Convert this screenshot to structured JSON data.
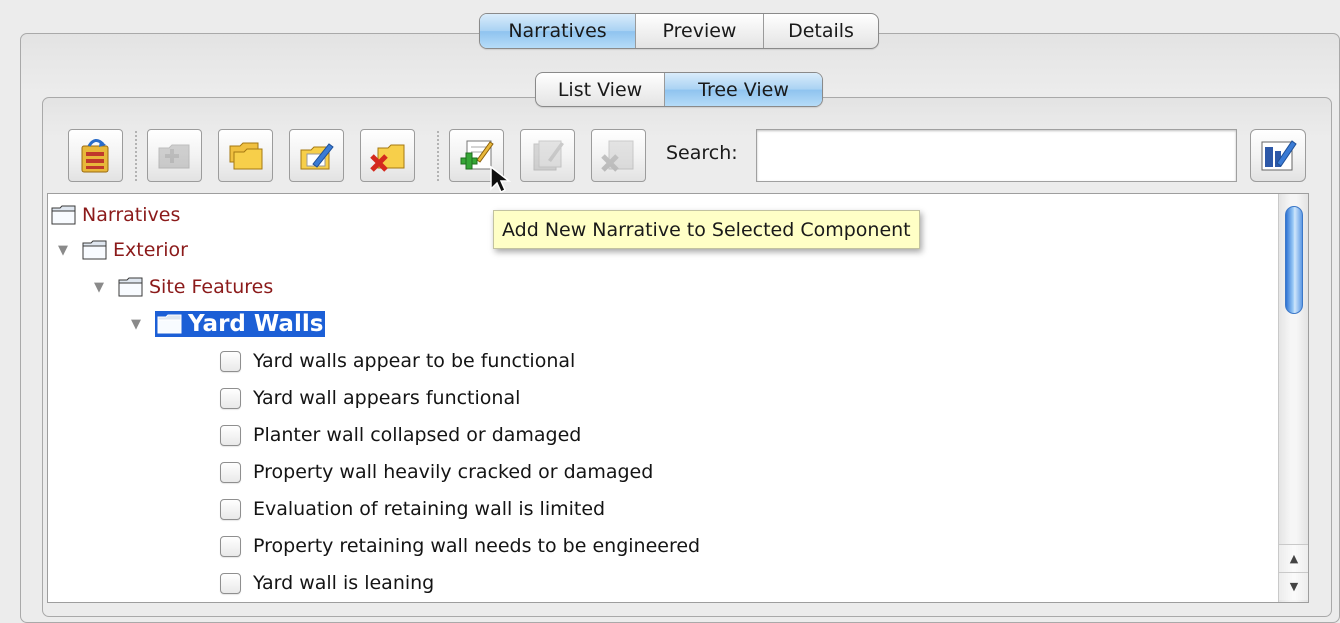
{
  "top_tabs": [
    {
      "label": "Narratives",
      "selected": true
    },
    {
      "label": "Preview",
      "selected": false
    },
    {
      "label": "Details",
      "selected": false
    }
  ],
  "view_tabs": [
    {
      "label": "List View",
      "selected": false
    },
    {
      "label": "Tree View",
      "selected": true
    }
  ],
  "toolbar": {
    "buttons": [
      {
        "icon": "reorder-component-icon",
        "enabled": true
      },
      {
        "icon": "folder-add-icon",
        "enabled": false
      },
      {
        "icon": "folders-icon",
        "enabled": true
      },
      {
        "icon": "folder-edit-icon",
        "enabled": true
      },
      {
        "icon": "folder-delete-icon",
        "enabled": true
      },
      {
        "icon": "add-narrative-icon",
        "enabled": true
      },
      {
        "icon": "edit-narrative-icon",
        "enabled": false
      },
      {
        "icon": "delete-narrative-icon",
        "enabled": false
      }
    ],
    "search_label": "Search:",
    "search_value": "",
    "right_button_icon": "narrative-tools-icon"
  },
  "tooltip": "Add New Narrative to Selected Component",
  "tree": {
    "root": "Narratives",
    "level1": "Exterior",
    "level2": "Site Features",
    "level3": "Yard Walls",
    "items": [
      "Yard walls appear to be functional",
      "Yard wall appears functional",
      "Planter wall collapsed or damaged",
      "Property wall heavily cracked or damaged",
      "Evaluation of retaining wall is limited",
      "Property retaining wall needs to be engineered",
      "Yard wall is leaning"
    ]
  },
  "colors": {
    "selection": "#1c5fd6",
    "folder_label": "#8b1a1a",
    "tooltip_bg": "#ffffc6",
    "tab_selected": "#a9d2f3"
  }
}
